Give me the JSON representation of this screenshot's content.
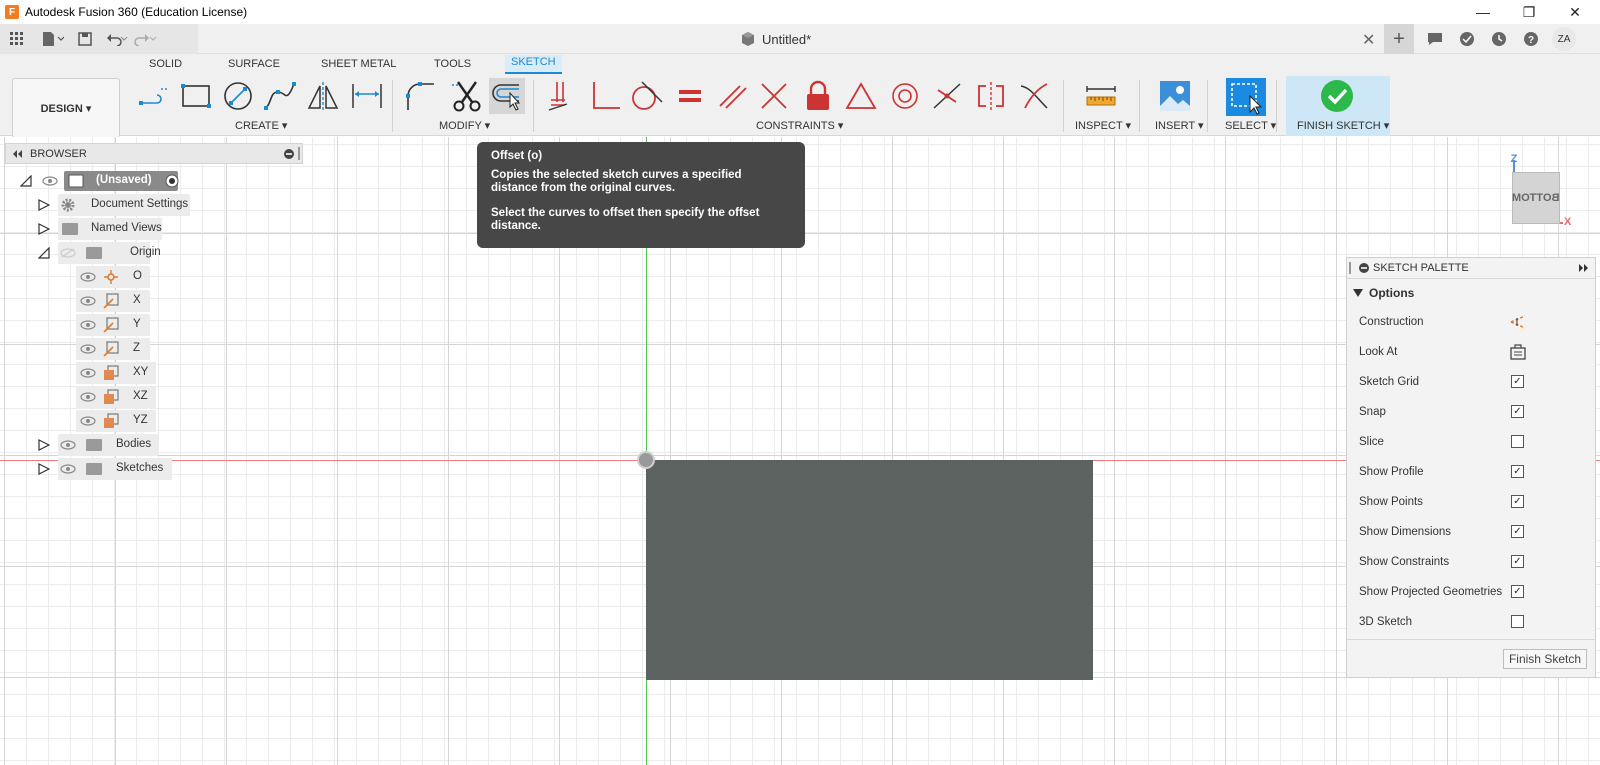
{
  "window": {
    "title": "Autodesk Fusion 360 (Education License)",
    "logo": "F",
    "minimize": "—",
    "maximize": "❐",
    "close": "✕"
  },
  "document": {
    "title": "Untitled*",
    "close": "✕"
  },
  "user": {
    "initials": "ZA"
  },
  "tabs": [
    {
      "label": "SOLID"
    },
    {
      "label": "SURFACE"
    },
    {
      "label": "SHEET METAL"
    },
    {
      "label": "TOOLS"
    },
    {
      "label": "SKETCH"
    }
  ],
  "workspace": {
    "label": "DESIGN ▾"
  },
  "groups": {
    "create": "CREATE ▾",
    "modify": "MODIFY ▾",
    "constraints": "CONSTRAINTS ▾",
    "inspect": "INSPECT ▾",
    "insert": "INSERT ▾",
    "select": "SELECT ▾",
    "finish": "FINISH SKETCH ▾"
  },
  "browser": {
    "title": "BROWSER",
    "items": [
      {
        "label": "(Unsaved)"
      },
      {
        "label": "Document Settings"
      },
      {
        "label": "Named Views"
      },
      {
        "label": "Origin"
      },
      {
        "label": "O"
      },
      {
        "label": "X"
      },
      {
        "label": "Y"
      },
      {
        "label": "Z"
      },
      {
        "label": "XY"
      },
      {
        "label": "XZ"
      },
      {
        "label": "YZ"
      },
      {
        "label": "Bodies"
      },
      {
        "label": "Sketches"
      }
    ]
  },
  "tooltip": {
    "title": "Offset (o)",
    "line1": "Copies the selected sketch curves a specified distance from the original curves.",
    "line2": "Select the curves to offset then specify the offset distance."
  },
  "viewcube": {
    "face": "BOTTOM",
    "z": "Z",
    "x": "X"
  },
  "palette": {
    "title": "SKETCH PALETTE",
    "section": "Options",
    "construction": "Construction",
    "look_at": "Look At",
    "options": [
      {
        "label": "Sketch Grid",
        "checked": true
      },
      {
        "label": "Snap",
        "checked": true
      },
      {
        "label": "Slice",
        "checked": false
      },
      {
        "label": "Show Profile",
        "checked": true
      },
      {
        "label": "Show Points",
        "checked": true
      },
      {
        "label": "Show Dimensions",
        "checked": true
      },
      {
        "label": "Show Constraints",
        "checked": true
      },
      {
        "label": "Show Projected Geometries",
        "checked": true
      },
      {
        "label": "3D Sketch",
        "checked": false
      }
    ],
    "finish_button": "Finish Sketch"
  },
  "colors": {
    "accent": "#1b8ad3",
    "tooltip_bg": "#474747",
    "sketch_profile": "#5c6260",
    "x_axis": "#f07d7d",
    "y_axis": "#52c452",
    "finish_green": "#2db84b"
  }
}
